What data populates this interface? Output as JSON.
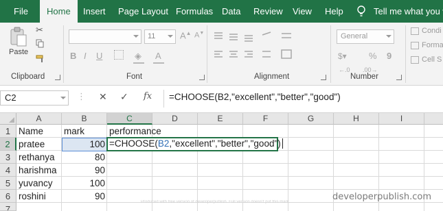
{
  "ribbon_tabs": [
    "File",
    "Home",
    "Insert",
    "Page Layout",
    "Formulas",
    "Data",
    "Review",
    "View",
    "Help"
  ],
  "active_tab": "Home",
  "tell_me": "Tell me what you wa",
  "ribbon": {
    "paste_label": "Paste",
    "clipboard_group": "Clipboard",
    "font_group": "Font",
    "font_size": "11",
    "alignment_group": "Alignment",
    "number_group": "Number",
    "number_format": "General",
    "percent_symbol": "%",
    "comma_symbol": "9",
    "styles": [
      "Condi",
      "Forma",
      "Cell S"
    ]
  },
  "formula_bar": {
    "name_box": "C2",
    "cancel_icon": "✕",
    "enter_icon": "✓",
    "fx_label": "fx",
    "formula": "=CHOOSE(B2,\"excellent\",\"better\",\"good\")"
  },
  "sheet": {
    "columns": [
      "A",
      "B",
      "C",
      "D",
      "E",
      "F",
      "G",
      "H",
      "I"
    ],
    "rows": [
      "1",
      "2",
      "3",
      "4",
      "5",
      "6",
      "7"
    ],
    "cells": {
      "A1": "Name",
      "B1": "mark",
      "C1": "performance",
      "A2": "pratee",
      "B2": "100",
      "A3": "rethanya",
      "B3": "80",
      "A4": "harishma",
      "B4": "90",
      "A5": "yuvancy",
      "B5": "100",
      "A6": "roshini",
      "B6": "90"
    },
    "editing_cell": {
      "prefix": "=CHOOSE(",
      "ref": "B2",
      "suffix": ",\"excellent\",\"better\",\"good\")"
    }
  },
  "watermark": "Produced with free version of developerpublish. Full version doesn't put this mark.",
  "brand": "developerpublish.com",
  "colors": {
    "excel_green": "#217346",
    "ref_blue": "#2f6eb5",
    "ribbon_bg": "#f3f3f3"
  }
}
